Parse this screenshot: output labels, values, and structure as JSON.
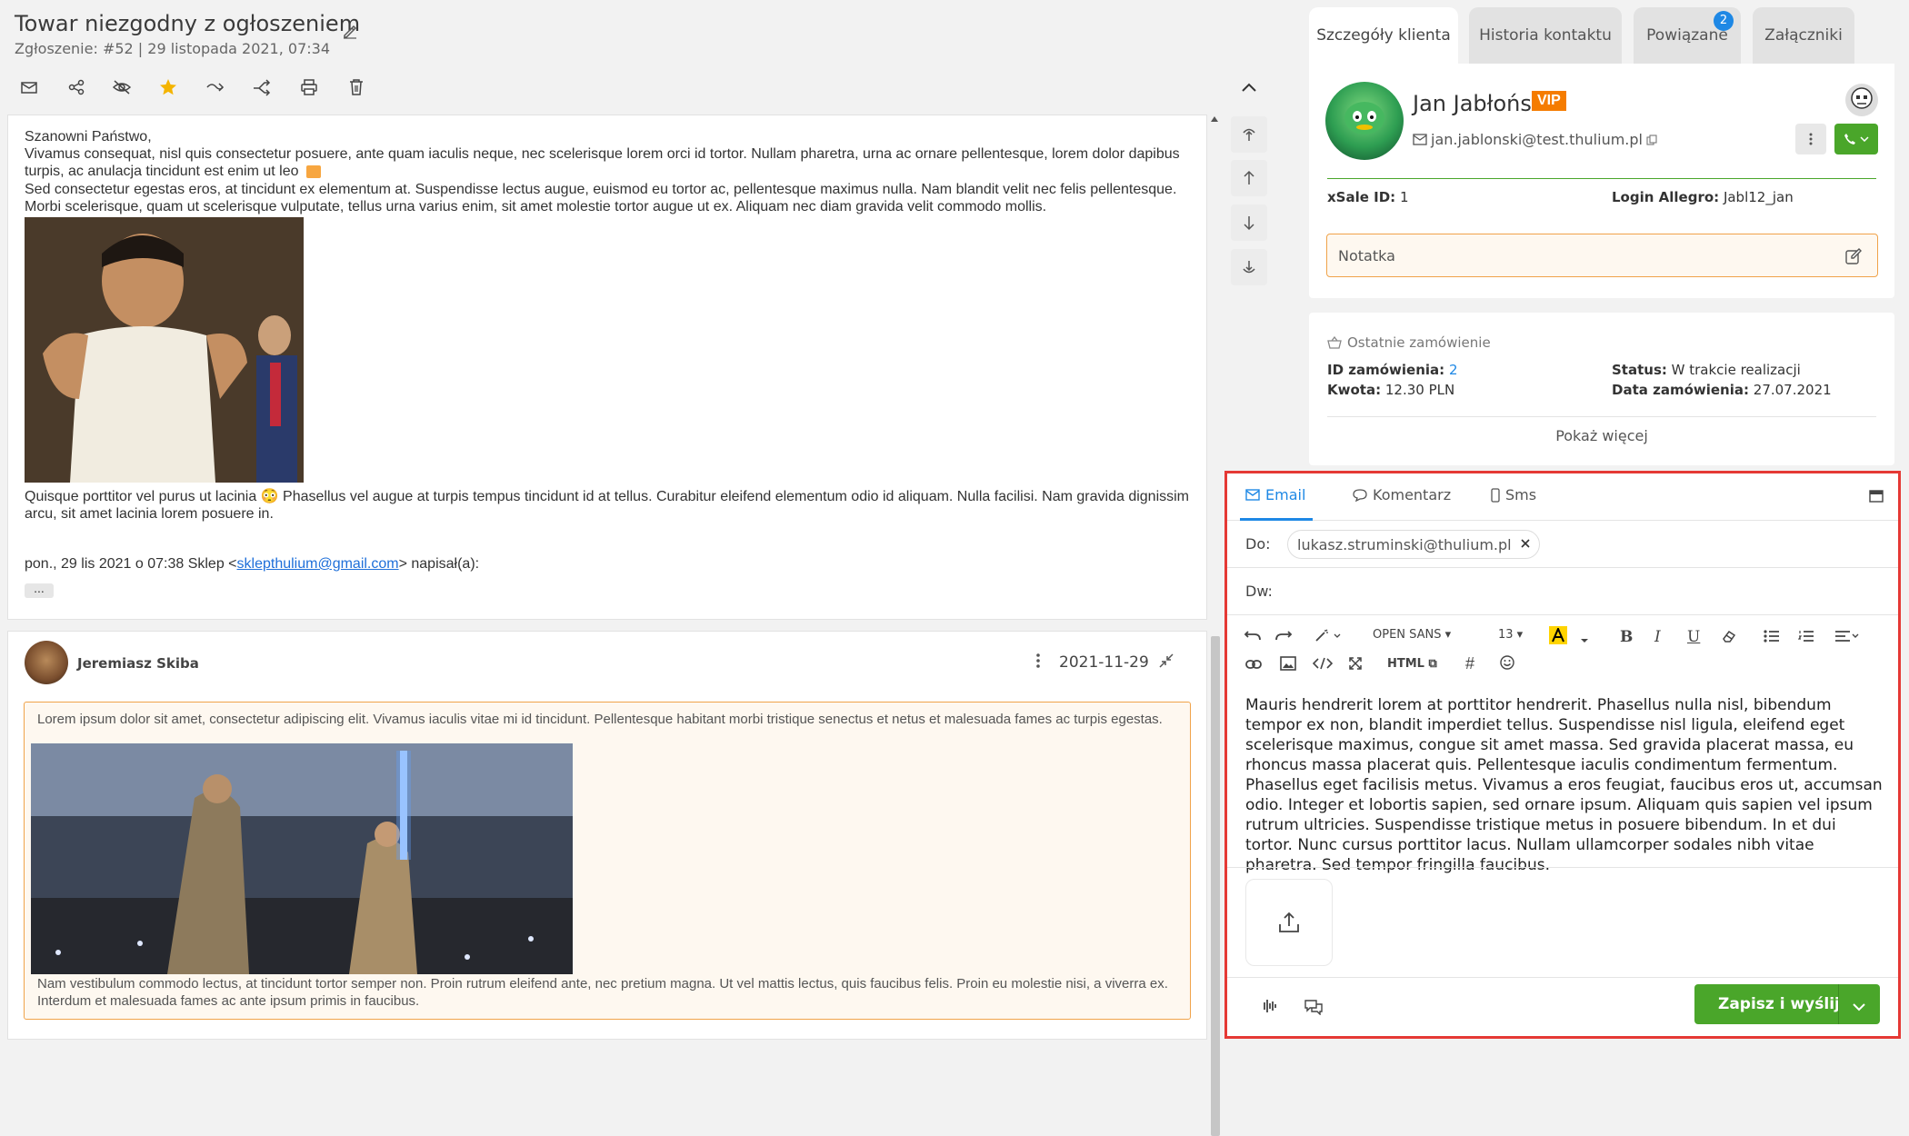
{
  "ticket": {
    "title": "Towar niezgodny z ogłoszeniem",
    "subtitle": "Zgłoszenie: #52 | 29 listopada 2021, 07:34"
  },
  "toolbar": {
    "icons": [
      "mail-icon",
      "share-icon",
      "eye-off-icon",
      "star-icon",
      "forward-icon",
      "split-icon",
      "print-icon",
      "trash-icon",
      "chevron-up-icon"
    ]
  },
  "message1": {
    "greeting": "Szanowni Państwo,",
    "para1": "Vivamus consequat, nisl quis consectetur posuere, ante quam iaculis neque, nec scelerisque lorem orci id tortor. Nullam pharetra, urna ac ornare pellentesque, lorem dolor dapibus turpis, ac anulacja tincidunt est enim ut leo",
    "para2": "Sed consectetur egestas eros, at tincidunt ex elementum at. Suspendisse lectus augue, euismod eu tortor ac, pellentesque maximus nulla. Nam blandit velit nec felis pellentesque. Morbi scelerisque, quam ut scelerisque vulputate, tellus urna varius enim, sit amet molestie tortor augue ut ex. Aliquam nec diam gravida velit commodo mollis.",
    "para3": "Quisque porttitor vel purus ut lacinia 😳 Phasellus vel augue at turpis tempus tincidunt id at tellus. Curabitur eleifend elementum odio id aliquam. Nulla facilisi. Nam gravida dignissim arcu, sit amet lacinia lorem posuere in.",
    "quote_prefix": "pon., 29 lis 2021 o 07:38 Sklep <",
    "quote_email": "sklepthulium@gmail.com",
    "quote_suffix": "> napisał(a):",
    "ellipsis": "..."
  },
  "message2": {
    "author": "Jeremiasz Skiba",
    "date": "2021-11-29",
    "para1": "Lorem ipsum dolor sit amet, consectetur adipiscing elit. Vivamus iaculis vitae mi id tincidunt. Pellentesque habitant morbi tristique senectus et netus et malesuada fames ac turpis egestas.",
    "para2": "Nam vestibulum commodo lectus, at tincidunt tortor semper non. Proin rutrum eleifend ante, nec pretium magna. Ut vel mattis lectus, quis faucibus felis. Proin eu molestie nisi, a viverra ex. Interdum et malesuada fames ac ante ipsum primis in faucibus."
  },
  "tabs": [
    {
      "label": "Szczegóły klienta",
      "active": true
    },
    {
      "label": "Historia kontaktu",
      "active": false
    },
    {
      "label": "Powiązane",
      "active": false,
      "badge": "2"
    },
    {
      "label": "Załączniki",
      "active": false
    }
  ],
  "client": {
    "name": "Jan Jabłoński",
    "vip": "VIP",
    "email": "jan.jablonski@test.thulium.pl",
    "xsale_label": "xSale ID:",
    "xsale_value": "1",
    "allegro_label": "Login Allegro:",
    "allegro_value": "Jabl12_jan",
    "note_placeholder": "Notatka"
  },
  "order": {
    "header": "Ostatnie zamówienie",
    "id_label": "ID zamówienia:",
    "id_value": "2",
    "status_label": "Status:",
    "status_value": "W trakcie realizacji",
    "amount_label": "Kwota:",
    "amount_value": "12.30 PLN",
    "date_label": "Data zamówienia:",
    "date_value": "27.07.2021",
    "more": "Pokaż więcej"
  },
  "composer": {
    "tabs": [
      {
        "label": "Email",
        "active": true
      },
      {
        "label": "Komentarz",
        "active": false
      },
      {
        "label": "Sms",
        "active": false
      }
    ],
    "to_label": "Do:",
    "to_value": "lukasz.struminski@thulium.pl",
    "cc_label": "Dw:",
    "font_name": "OPEN SANS",
    "font_size": "13",
    "html_label": "HTML",
    "body": "Mauris hendrerit lorem at porttitor hendrerit. Phasellus nulla nisl, bibendum tempor ex non, blandit imperdiet tellus. Suspendisse nisl ligula, eleifend eget scelerisque maximus, congue sit amet massa. Sed gravida placerat massa, eu rhoncus massa placerat quis. Pellentesque iaculis condimentum fermentum. Phasellus eget facilisis metus. Vivamus a eros feugiat, faucibus eros ut, accumsan odio. Integer et lobortis sapien, sed ornare ipsum. Aliquam quis sapien vel ipsum rutrum ultricies. Suspendisse tristique metus in posuere bibendum. In et dui tortor. Nunc cursus porttitor lacus. Nullam ullamcorper sodales nibh vitae pharetra. Sed tempor fringilla faucibus.",
    "send_label": "Zapisz i wyślij"
  },
  "colors": {
    "accent": "#1e88e5",
    "green": "#4aa62a",
    "vip": "#f57c00",
    "highlight_border": "#e53935",
    "quote_border": "#f0a34a"
  }
}
